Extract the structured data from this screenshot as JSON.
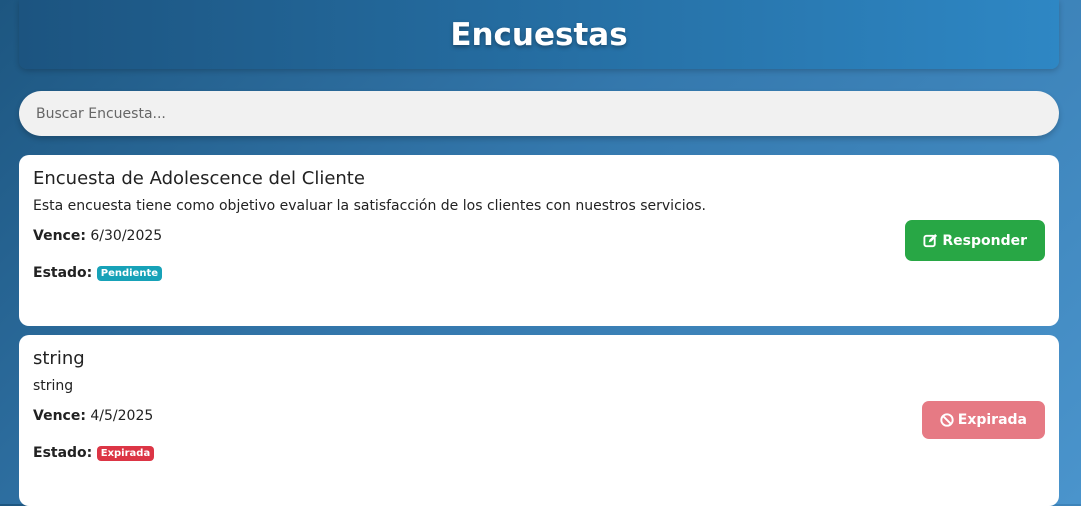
{
  "header": {
    "title": "Encuestas"
  },
  "search": {
    "placeholder": "Buscar Encuesta..."
  },
  "surveys": [
    {
      "title": "Encuesta de Adolescence del Cliente",
      "description": "Esta encuesta tiene como objetivo evaluar la satisfacción de los clientes con nuestros servicios.",
      "due_label": "Vence:",
      "due": "6/30/2025",
      "status_label": "Estado:",
      "status": "Pendiente",
      "status_color": "#17a2b8",
      "action": "Responder",
      "action_icon": "edit-icon",
      "action_color": "#28a745"
    },
    {
      "title": "string",
      "description": "string",
      "due_label": "Vence:",
      "due": "4/5/2025",
      "status_label": "Estado:",
      "status": "Expirada",
      "status_color": "#dc3545",
      "action": "Expirada",
      "action_icon": "ban-icon",
      "action_color": "#e67a84"
    }
  ]
}
